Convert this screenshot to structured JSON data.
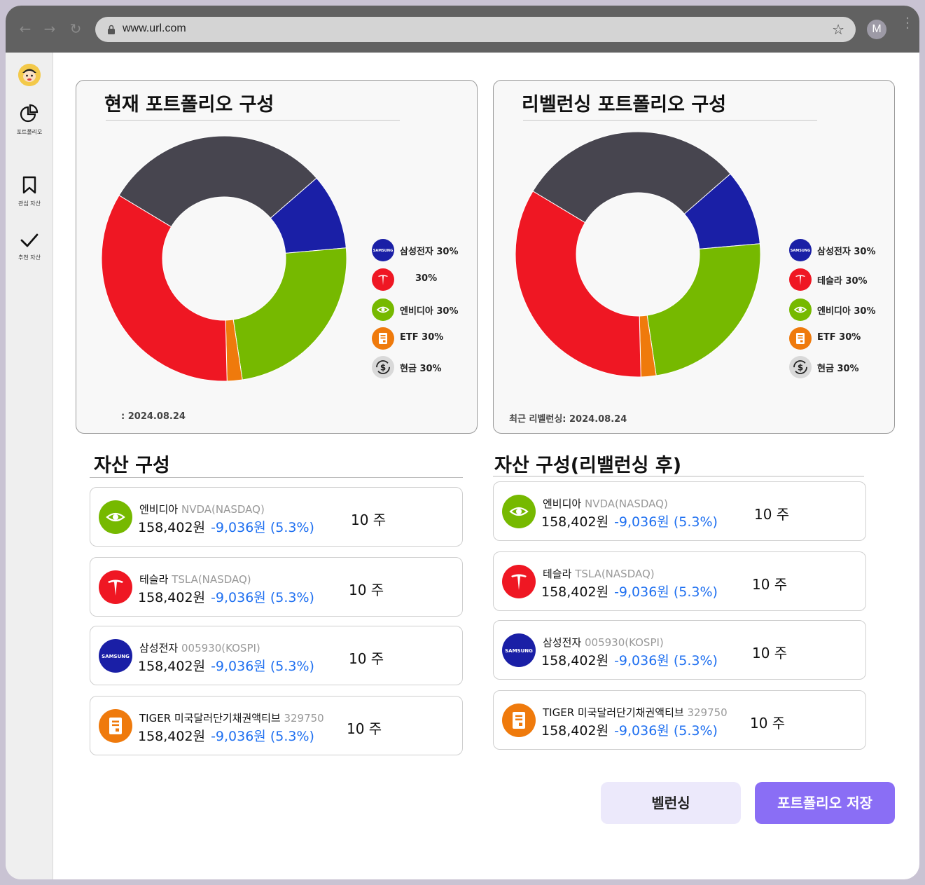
{
  "browser": {
    "url": "www.url.com",
    "profile_initial": "M"
  },
  "sidebar": {
    "items": [
      {
        "label": "포트폴리오",
        "icon": "pie-chart-icon"
      },
      {
        "label": "관심 자산",
        "icon": "bookmark-icon"
      },
      {
        "label": "추천 자산",
        "icon": "checkmark-icon"
      }
    ]
  },
  "current_portfolio": {
    "title": "현재 포트폴리오 구성",
    "date_label": ": 2024.08.24",
    "legend": [
      {
        "label": "삼성전자 30%",
        "icon": "samsung-logo-icon",
        "color": "#1a1fa6"
      },
      {
        "label": "30%",
        "icon": "tesla-logo-icon",
        "color": "#ef1723"
      },
      {
        "label": "엔비디아 30%",
        "icon": "nvidia-logo-icon",
        "color": "#76b900"
      },
      {
        "label": "ETF 30%",
        "icon": "etf-document-icon",
        "color": "#ef7a0c"
      },
      {
        "label": "현금 30%",
        "icon": "cash-exchange-icon",
        "color": "#d9d9d9"
      }
    ]
  },
  "rebalanced_portfolio": {
    "title": "리벨런싱 포트폴리오 구성",
    "date_label": "최근 리벨런싱: 2024.08.24",
    "legend": [
      {
        "label": "삼성전자 30%",
        "icon": "samsung-logo-icon",
        "color": "#1a1fa6"
      },
      {
        "label": "테슬라 30%",
        "icon": "tesla-logo-icon",
        "color": "#ef1723"
      },
      {
        "label": "엔비디아 30%",
        "icon": "nvidia-logo-icon",
        "color": "#76b900"
      },
      {
        "label": "ETF 30%",
        "icon": "etf-document-icon",
        "color": "#ef7a0c"
      },
      {
        "label": "현금 30%",
        "icon": "cash-exchange-icon",
        "color": "#d9d9d9"
      }
    ]
  },
  "chart_data": [
    {
      "type": "pie",
      "title": "현재 포트폴리오 구성",
      "donut": true,
      "slices": [
        {
          "name": "cash",
          "value": 30,
          "color": "#47454f"
        },
        {
          "name": "samsung",
          "value": 10,
          "color": "#1a1fa6"
        },
        {
          "name": "nvidia",
          "value": 24,
          "color": "#76b900"
        },
        {
          "name": "etf",
          "value": 2,
          "color": "#ef7a0c"
        },
        {
          "name": "tesla",
          "value": 34,
          "color": "#ef1723"
        }
      ]
    },
    {
      "type": "pie",
      "title": "리벨런싱 포트폴리오 구성",
      "donut": true,
      "slices": [
        {
          "name": "cash",
          "value": 30,
          "color": "#47454f"
        },
        {
          "name": "samsung",
          "value": 10,
          "color": "#1a1fa6"
        },
        {
          "name": "nvidia",
          "value": 24,
          "color": "#76b900"
        },
        {
          "name": "etf",
          "value": 2,
          "color": "#ef7a0c"
        },
        {
          "name": "tesla",
          "value": 34,
          "color": "#ef1723"
        }
      ]
    }
  ],
  "assets_current": {
    "title": "자산 구성",
    "items": [
      {
        "name": "엔비디아",
        "code": "NVDA(NASDAQ)",
        "price": "158,402원",
        "change": "-9,036원 (5.3%)",
        "qty": "10 주",
        "icon": "nvidia-logo-icon"
      },
      {
        "name": "테슬라",
        "code": "TSLA(NASDAQ)",
        "price": "158,402원",
        "change": "-9,036원 (5.3%)",
        "qty": "10 주",
        "icon": "tesla-logo-icon"
      },
      {
        "name": "삼성전자",
        "code": "005930(KOSPI)",
        "price": "158,402원",
        "change": "-9,036원 (5.3%)",
        "qty": "10 주",
        "icon": "samsung-logo-icon"
      },
      {
        "name": "TIGER 미국달러단기채권액티브",
        "code": "329750",
        "price": "158,402원",
        "change": "-9,036원 (5.3%)",
        "qty": "10 주",
        "icon": "etf-document-icon"
      }
    ]
  },
  "assets_rebalanced": {
    "title": "자산 구성(리밸런싱 후)",
    "items": [
      {
        "name": "엔비디아",
        "code": "NVDA(NASDAQ)",
        "price": "158,402원",
        "change": "-9,036원 (5.3%)",
        "qty": "10 주",
        "icon": "nvidia-logo-icon"
      },
      {
        "name": "테슬라",
        "code": "TSLA(NASDAQ)",
        "price": "158,402원",
        "change": "-9,036원 (5.3%)",
        "qty": "10 주",
        "icon": "tesla-logo-icon"
      },
      {
        "name": "삼성전자",
        "code": "005930(KOSPI)",
        "price": "158,402원",
        "change": "-9,036원 (5.3%)",
        "qty": "10 주",
        "icon": "samsung-logo-icon"
      },
      {
        "name": "TIGER 미국달러단기채권액티브",
        "code": "329750",
        "price": "158,402원",
        "change": "-9,036원 (5.3%)",
        "qty": "10 주",
        "icon": "etf-document-icon"
      }
    ]
  },
  "actions": {
    "rebalance_label": "벨런싱",
    "save_label": "포트폴리오 저장"
  },
  "icon_text": {
    "samsung": "SAMSUNG"
  }
}
